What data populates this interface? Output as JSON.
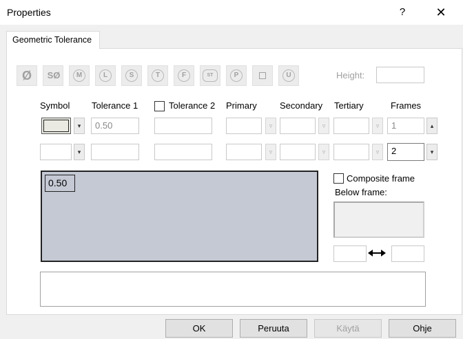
{
  "window": {
    "title": "Properties",
    "help": "?",
    "close": "✕"
  },
  "tab": {
    "label": "Geometric Tolerance"
  },
  "symbols": [
    {
      "icon": "diameter-icon",
      "glyph": "Ø"
    },
    {
      "icon": "spherical-diameter-icon",
      "glyph": "SØ"
    },
    {
      "icon": "mmc-icon",
      "glyph": "M"
    },
    {
      "icon": "lmc-icon",
      "glyph": "L"
    },
    {
      "icon": "rfs-icon",
      "glyph": "S"
    },
    {
      "icon": "tangent-plane-icon",
      "glyph": "T"
    },
    {
      "icon": "free-state-icon",
      "glyph": "F"
    },
    {
      "icon": "statistical-icon",
      "glyph": "ST"
    },
    {
      "icon": "projected-zone-icon",
      "glyph": "P"
    },
    {
      "icon": "square-icon",
      "glyph": "□"
    },
    {
      "icon": "unequally-disposed-icon",
      "glyph": "U"
    }
  ],
  "height": {
    "label": "Height:",
    "value": ""
  },
  "columns": {
    "symbol": "Symbol",
    "tolerance1": "Tolerance 1",
    "tolerance2": "Tolerance 2",
    "primary": "Primary",
    "secondary": "Secondary",
    "tertiary": "Tertiary",
    "frames": "Frames"
  },
  "row1": {
    "tolerance1": "0.50",
    "tolerance2": "",
    "primary": "",
    "secondary": "",
    "tertiary": "",
    "frames": "1"
  },
  "row2": {
    "tolerance1": "",
    "tolerance2": "",
    "primary": "",
    "secondary": "",
    "tertiary": "",
    "frames": "2"
  },
  "preview": {
    "frame_text": "0.50"
  },
  "composite": {
    "label": "Composite frame",
    "checked": false
  },
  "below_frame": {
    "label": "Below frame:"
  },
  "spacing": {
    "left": "",
    "right": ""
  },
  "buttons": {
    "ok": "OK",
    "cancel": "Peruuta",
    "apply": "Käytä",
    "help": "Ohje"
  }
}
